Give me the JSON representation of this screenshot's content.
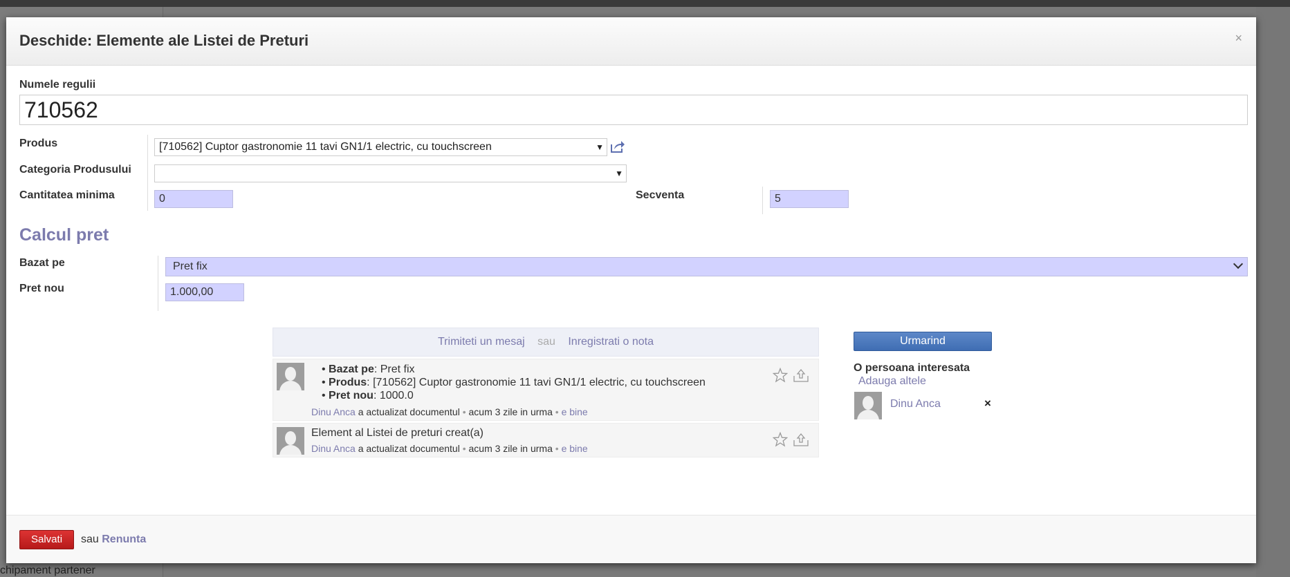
{
  "background": {
    "sidebar_bottom_text": "chipament partener"
  },
  "dialog": {
    "title": "Deschide: Elemente ale Listei de Preturi",
    "close_symbol": "×"
  },
  "form": {
    "rule_name_label": "Numele regulii",
    "rule_name_value": "710562",
    "product_label": "Produs",
    "product_value": "[710562] Cuptor gastronomie 11 tavi GN1/1 electric, cu touchscreen",
    "product_category_label": "Categoria Produsului",
    "product_category_value": "",
    "min_quantity_label": "Cantitatea minima",
    "min_quantity_value": "0",
    "sequence_label": "Secventa",
    "sequence_value": "5"
  },
  "price_section": {
    "title": "Calcul pret",
    "based_on_label": "Bazat pe",
    "based_on_value": "Pret fix",
    "new_price_label": "Pret nou",
    "new_price_value": "1.000,00"
  },
  "chatter": {
    "send_message": "Trimiteti un mesaj",
    "or": "sau",
    "log_note": "Inregistrati o nota",
    "messages": [
      {
        "changes": [
          {
            "field": "Bazat pe",
            "value": ": Pret fix"
          },
          {
            "field": "Produs",
            "value": ": [710562] Cuptor gastronomie 11 tavi GN1/1 electric, cu touchscreen"
          },
          {
            "field": "Pret nou",
            "value": ": 1000.0"
          }
        ],
        "author": "Dinu Anca",
        "action": " a actualizat documentul ",
        "time": " acum 3 zile in urma ",
        "link": "e bine"
      },
      {
        "text": "Element al Listei de preturi creat(a)",
        "author": "Dinu Anca",
        "action": " a actualizat documentul ",
        "time": " acum 3 zile in urma ",
        "link": "e bine"
      }
    ]
  },
  "followers": {
    "button_label": "Urmarind",
    "title": "O persoana interesata",
    "add_others": "Adauga altele",
    "list": [
      {
        "name": "Dinu Anca",
        "remove_symbol": "×"
      }
    ]
  },
  "footer": {
    "save_label": "Salvati",
    "or_label": "sau ",
    "discard_label": "Renunta"
  },
  "colors": {
    "accent": "#7c7bad",
    "required_field": "#d2d2ff",
    "save_button": "#c62828",
    "follow_button": "#4a78be"
  }
}
